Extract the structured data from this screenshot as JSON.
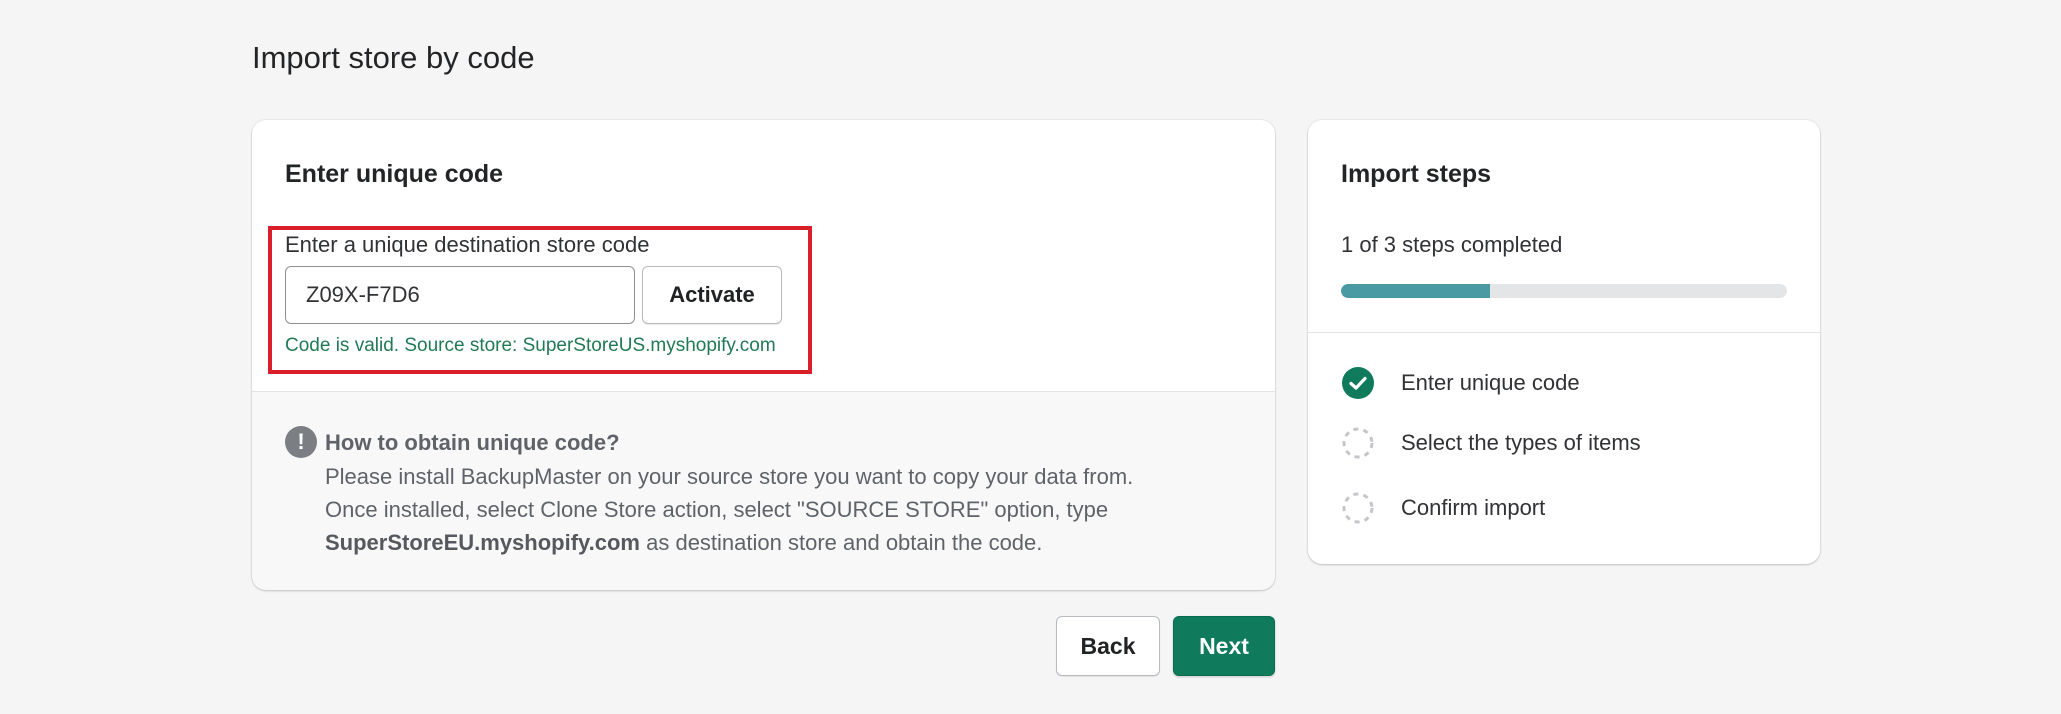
{
  "page": {
    "title": "Import store by code"
  },
  "code_card": {
    "heading": "Enter unique code",
    "field_label": "Enter a unique destination store code",
    "input_value": "Z09X-F7D6",
    "activate_label": "Activate",
    "valid_message": "Code is valid. Source store: SuperStoreUS.myshopify.com",
    "highlight_color": "#d9202a"
  },
  "info": {
    "icon": "exclamation-icon",
    "title": "How to obtain unique code?",
    "line1": "Please install BackupMaster on your source store you want to copy your data from.",
    "line2": "Once installed, select Clone Store action, select \"SOURCE STORE\" option, type",
    "line3_bold": "SuperStoreEU.myshopify.com",
    "line3_rest": " as destination store and obtain the code."
  },
  "steps_card": {
    "heading": "Import steps",
    "progress_text": "1 of 3 steps completed",
    "progress_fraction": 0.333,
    "steps": [
      {
        "label": "Enter unique code",
        "status": "completed",
        "icon": "check-circle-icon"
      },
      {
        "label": "Select the types of items",
        "status": "pending",
        "icon": "dashed-circle-icon"
      },
      {
        "label": "Confirm import",
        "status": "pending",
        "icon": "dashed-circle-icon"
      }
    ]
  },
  "footer": {
    "back_label": "Back",
    "next_label": "Next"
  },
  "colors": {
    "primary_green": "#0f7a5c",
    "success_text": "#217a57",
    "progress_fill": "#4a9aa4"
  }
}
